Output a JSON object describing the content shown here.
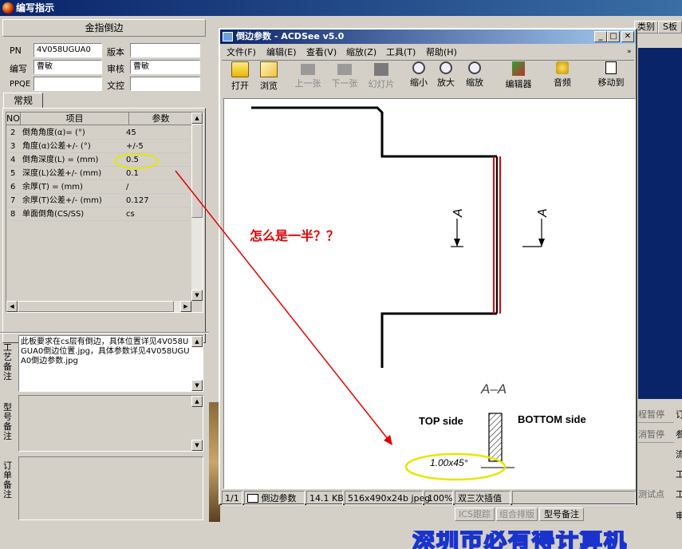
{
  "main_title": "编写指示",
  "left": {
    "header": "金指倒边",
    "pn_label": "PN",
    "pn_value": "4V058UGUA0",
    "version_label": "版本",
    "version_value": "",
    "writer_label": "编写",
    "writer_value": "曹敏",
    "reviewer_label": "审核",
    "reviewer_value": "曹敏",
    "ppqe_label": "PPQE",
    "ppqe_value": "",
    "doc_control_label": "文控",
    "doc_control_value": "",
    "tab_label": "常规",
    "table": {
      "headers": [
        "NO",
        "项目",
        "参数"
      ],
      "rows": [
        {
          "no": "2",
          "item": "倒角角度(α)=  (°)",
          "value": "45"
        },
        {
          "no": "3",
          "item": "角度(α)公差+/-  (°)",
          "value": "+/-5"
        },
        {
          "no": "4",
          "item": "倒角深度(L) =  (mm)",
          "value": "0.5"
        },
        {
          "no": "5",
          "item": "深度(L)公差+/-  (mm)",
          "value": "0.1"
        },
        {
          "no": "6",
          "item": "余厚(T) =  (mm)",
          "value": "/"
        },
        {
          "no": "7",
          "item": "余厚(T)公差+/-  (mm)",
          "value": "0.127"
        },
        {
          "no": "8",
          "item": "单面倒角(CS/SS)",
          "value": "cs"
        }
      ]
    },
    "process_note_label": "工艺备注",
    "process_note_text": "此板要求在cs层有倒边，具体位置详见4V058UGUA0倒边位置.jpg，具体参数详见4V058UGUA0倒边参数.jpg",
    "model_note_label": "型号备注",
    "order_note_label": "订单备注"
  },
  "acdsee": {
    "title": "倒边参数 - ACDSee v5.0",
    "menu": [
      "文件(F)",
      "编辑(E)",
      "查看(V)",
      "缩放(Z)",
      "工具(T)",
      "帮助(H)"
    ],
    "toolbar": [
      "打开",
      "浏览",
      "上一张",
      "下一张",
      "幻灯片",
      "缩小",
      "放大",
      "缩放",
      "编辑器",
      "音频",
      "移动到"
    ],
    "drawing": {
      "section_a_left": "A",
      "section_a_right": "A",
      "section_title": "A–A",
      "top_side": "TOP side",
      "bottom_side": "BOTTOM  side",
      "chamfer_label": "1.00x45°"
    },
    "status": [
      "1/1",
      "倒边参数",
      "14.1 KB",
      "516x490x24b jpeg",
      "100%",
      "双三次插值"
    ]
  },
  "annotation_text": "怎么是一半？？",
  "background": {
    "header_cells": [
      "类别",
      "S板"
    ],
    "right_cells": [
      "程暂停",
      "消暂停",
      "测试点",
      "订",
      "参",
      "流",
      "工",
      "工",
      "审"
    ],
    "bottom_tabs": [
      "ICS跟踪",
      "组合排版",
      "型号备注"
    ],
    "bottom_banner": "深圳市必有得计算机"
  },
  "colors": {
    "title_bar": "#0a246a",
    "annotation_red": "#e00000",
    "highlight_yellow": "#e6e600"
  }
}
